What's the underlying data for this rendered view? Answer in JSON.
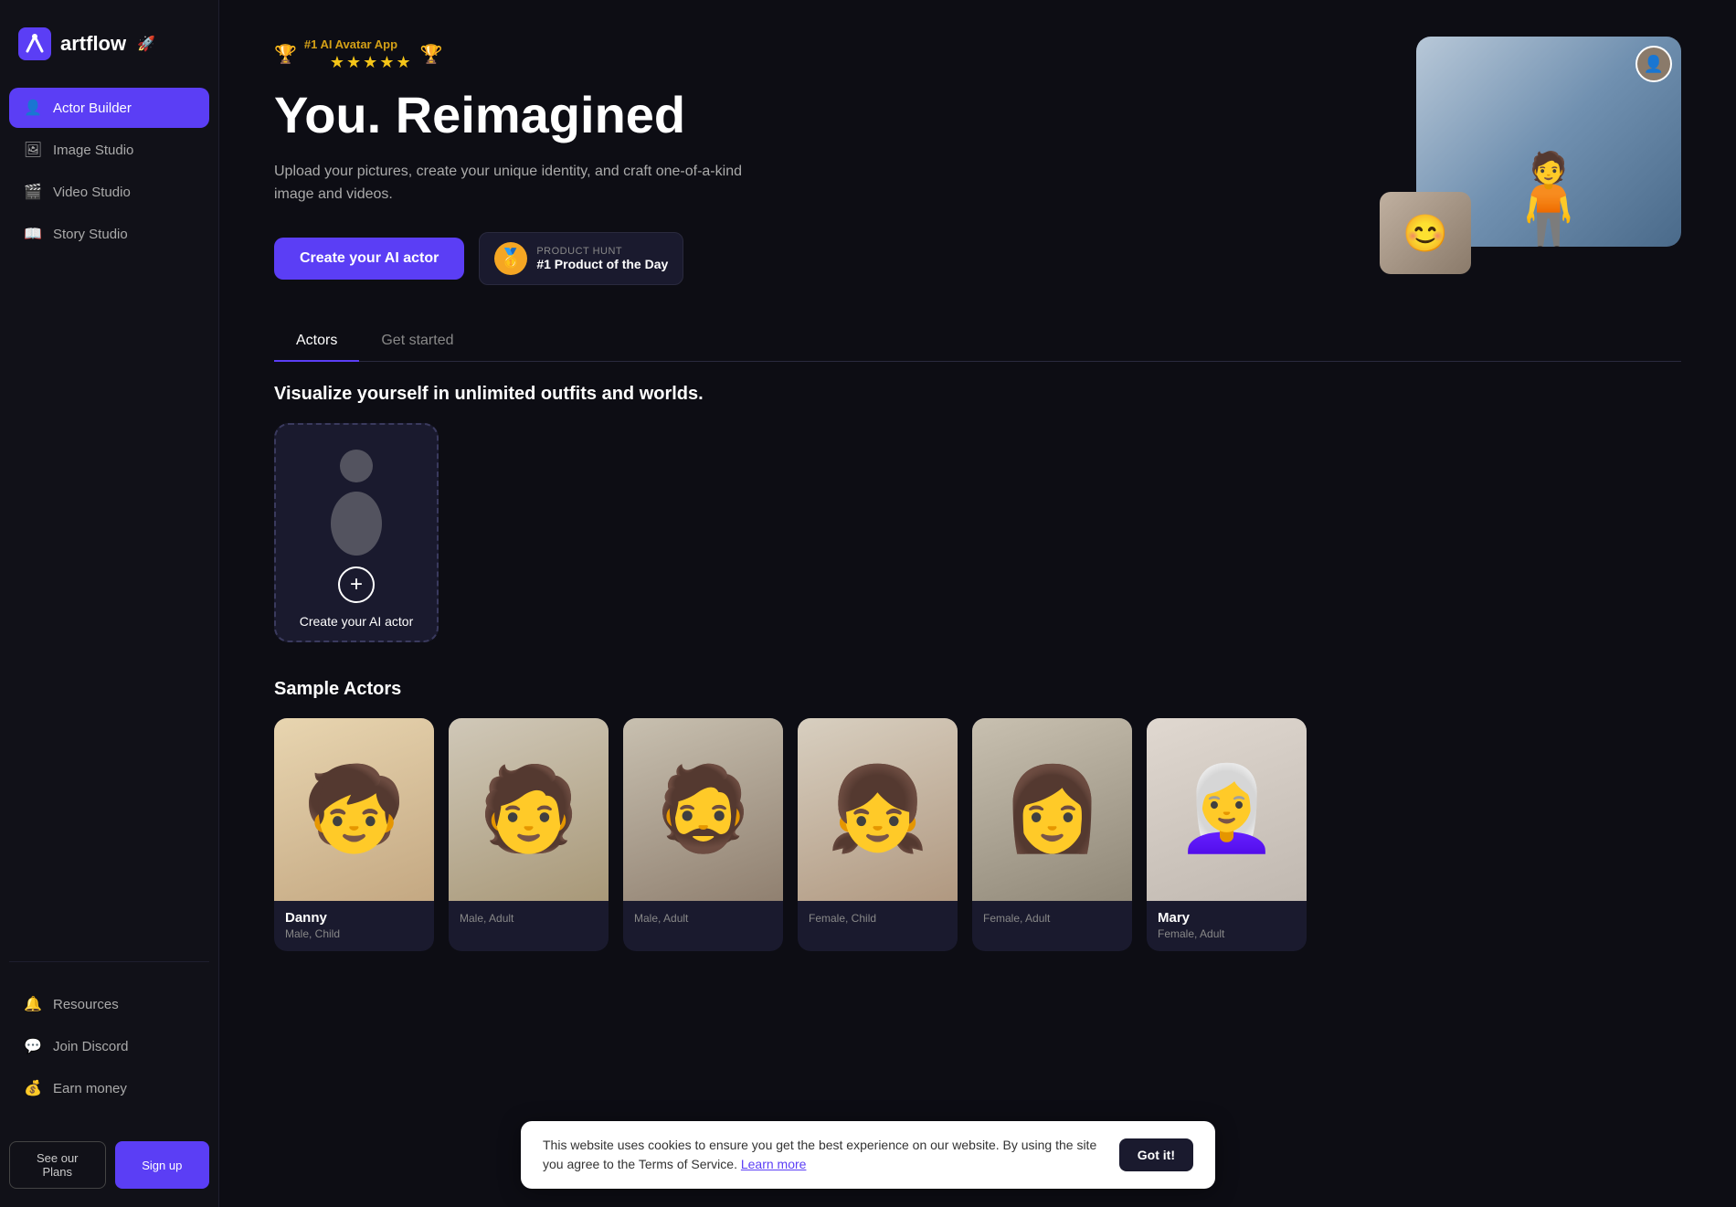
{
  "app": {
    "name": "artflow",
    "logo_emoji": "🚀"
  },
  "sidebar": {
    "nav_items": [
      {
        "id": "actor-builder",
        "label": "Actor Builder",
        "icon": "👤",
        "active": true
      },
      {
        "id": "image-studio",
        "label": "Image Studio",
        "icon": "🖼",
        "active": false
      },
      {
        "id": "video-studio",
        "label": "Video Studio",
        "icon": "🎬",
        "active": false
      },
      {
        "id": "story-studio",
        "label": "Story Studio",
        "icon": "📖",
        "active": false
      }
    ],
    "bottom_items": [
      {
        "id": "resources",
        "label": "Resources",
        "icon": "🔔"
      },
      {
        "id": "join-discord",
        "label": "Join Discord",
        "icon": "💬"
      },
      {
        "id": "earn-money",
        "label": "Earn money",
        "icon": "💰"
      }
    ],
    "see_plans_label": "See our Plans",
    "sign_up_label": "Sign up"
  },
  "hero": {
    "badge_text": "#1 AI Avatar App",
    "stars": "★★★★★",
    "title": "You. Reimagined",
    "subtitle": "Upload your pictures, create your unique identity, and craft one-of-a-kind image and videos.",
    "cta_label": "Create your AI actor",
    "product_hunt": {
      "label": "PRODUCT HUNT",
      "title": "#1 Product of the Day"
    }
  },
  "tabs": [
    {
      "id": "actors",
      "label": "Actors",
      "active": true
    },
    {
      "id": "get-started",
      "label": "Get started",
      "active": false
    }
  ],
  "actors_section": {
    "visualize_title": "Visualize yourself in unlimited outfits and worlds.",
    "create_card_label": "Create your AI actor",
    "sample_title": "Sample Actors",
    "actors": [
      {
        "name": "Danny",
        "desc": "Male, Child",
        "emoji": "🧒",
        "bg": "actor-bg-1"
      },
      {
        "name": "",
        "desc": "Male, Adult",
        "emoji": "🧑",
        "bg": "actor-bg-2"
      },
      {
        "name": "",
        "desc": "Male, Adult",
        "emoji": "🧔",
        "bg": "actor-bg-3"
      },
      {
        "name": "",
        "desc": "Female, Child",
        "emoji": "👧",
        "bg": "actor-bg-4"
      },
      {
        "name": "",
        "desc": "Female, Adult",
        "emoji": "👩",
        "bg": "actor-bg-5"
      },
      {
        "name": "Mary",
        "desc": "Female, Adult",
        "emoji": "👩‍🦳",
        "bg": "actor-bg-6"
      }
    ]
  },
  "cookie": {
    "text": "This website uses cookies to ensure you get the best experience on our website. By using the site you agree to the Terms of Service.",
    "link_text": "Learn more",
    "button_label": "Got it!"
  }
}
